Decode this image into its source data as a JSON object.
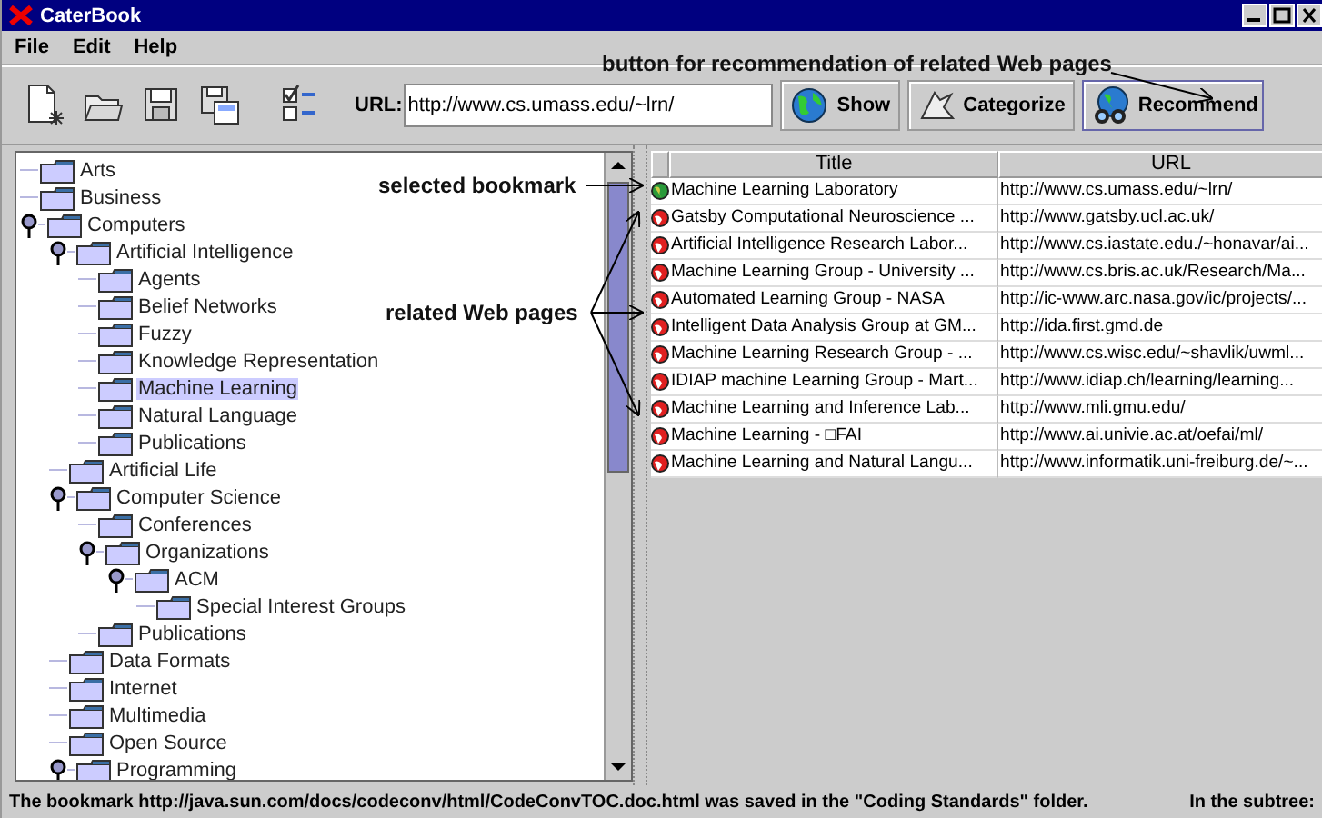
{
  "window": {
    "title": "CaterBook"
  },
  "menu": [
    "File",
    "Edit",
    "Help"
  ],
  "toolbar": {
    "url_label": "URL:",
    "url": "http://www.cs.umass.edu/~lrn/",
    "buttons": [
      "Show",
      "Categorize",
      "Recommend"
    ]
  },
  "tree": [
    {
      "label": "Arts",
      "selected": false
    },
    {
      "label": "Business",
      "selected": false
    },
    {
      "label": "Computers",
      "selected": false,
      "expanded": true,
      "children": [
        {
          "label": "Artificial Intelligence",
          "selected": false,
          "expanded": true,
          "children": [
            {
              "label": "Agents",
              "selected": false
            },
            {
              "label": "Belief Networks",
              "selected": false
            },
            {
              "label": "Fuzzy",
              "selected": false
            },
            {
              "label": "Knowledge Representation",
              "selected": false
            },
            {
              "label": "Machine Learning",
              "selected": true
            },
            {
              "label": "Natural Language",
              "selected": false
            },
            {
              "label": "Publications",
              "selected": false
            }
          ]
        },
        {
          "label": "Artificial Life",
          "selected": false
        },
        {
          "label": "Computer Science",
          "selected": false,
          "expanded": true,
          "children": [
            {
              "label": "Conferences",
              "selected": false
            },
            {
              "label": "Organizations",
              "selected": false,
              "expanded": true,
              "children": [
                {
                  "label": "ACM",
                  "selected": false,
                  "expanded": true,
                  "children": [
                    {
                      "label": "Special Interest Groups",
                      "selected": false
                    }
                  ]
                }
              ]
            },
            {
              "label": "Publications",
              "selected": false
            }
          ]
        },
        {
          "label": "Data Formats",
          "selected": false
        },
        {
          "label": "Internet",
          "selected": false
        },
        {
          "label": "Multimedia",
          "selected": false
        },
        {
          "label": "Open Source",
          "selected": false
        },
        {
          "label": "Programming",
          "selected": false,
          "expanded": true
        }
      ]
    }
  ],
  "table": {
    "columns": [
      "Title",
      "URL"
    ],
    "rows": [
      {
        "kind": "bookmark",
        "title": "Machine Learning Laboratory",
        "url": "http://www.cs.umass.edu/~lrn/"
      },
      {
        "kind": "related",
        "title": "Gatsby Computational Neuroscience ...",
        "url": "http://www.gatsby.ucl.ac.uk/"
      },
      {
        "kind": "related",
        "title": "Artificial Intelligence Research Labor...",
        "url": "http://www.cs.iastate.edu./~honavar/ai..."
      },
      {
        "kind": "related",
        "title": "Machine Learning Group - University ...",
        "url": "http://www.cs.bris.ac.uk/Research/Ma..."
      },
      {
        "kind": "related",
        "title": "Automated Learning Group - NASA",
        "url": "http://ic-www.arc.nasa.gov/ic/projects/..."
      },
      {
        "kind": "related",
        "title": "Intelligent Data Analysis Group at GM...",
        "url": "http://ida.first.gmd.de"
      },
      {
        "kind": "related",
        "title": "Machine Learning Research Group - ...",
        "url": "http://www.cs.wisc.edu/~shavlik/uwml..."
      },
      {
        "kind": "related",
        "title": "IDIAP machine Learning Group - Mart...",
        "url": "http://www.idiap.ch/learning/learning..."
      },
      {
        "kind": "related",
        "title": "Machine Learning and Inference Lab...",
        "url": "http://www.mli.gmu.edu/"
      },
      {
        "kind": "related",
        "title": "Machine Learning - □FAI",
        "url": "http://www.ai.univie.ac.at/oefai/ml/"
      },
      {
        "kind": "related",
        "title": "Machine Learning and Natural Langu...",
        "url": "http://www.informatik.uni-freiburg.de/~..."
      }
    ]
  },
  "status_bar": {
    "message": "The bookmark http://java.sun.com/docs/codeconv/html/CodeConvTOC.doc.html was saved in the \"Coding Standards\" folder.",
    "subtree_label": "In the subtree:"
  },
  "annotations": [
    {
      "text": "button for recommendation of related Web pages"
    },
    {
      "text": "selected bookmark"
    },
    {
      "text": "related Web pages"
    }
  ]
}
